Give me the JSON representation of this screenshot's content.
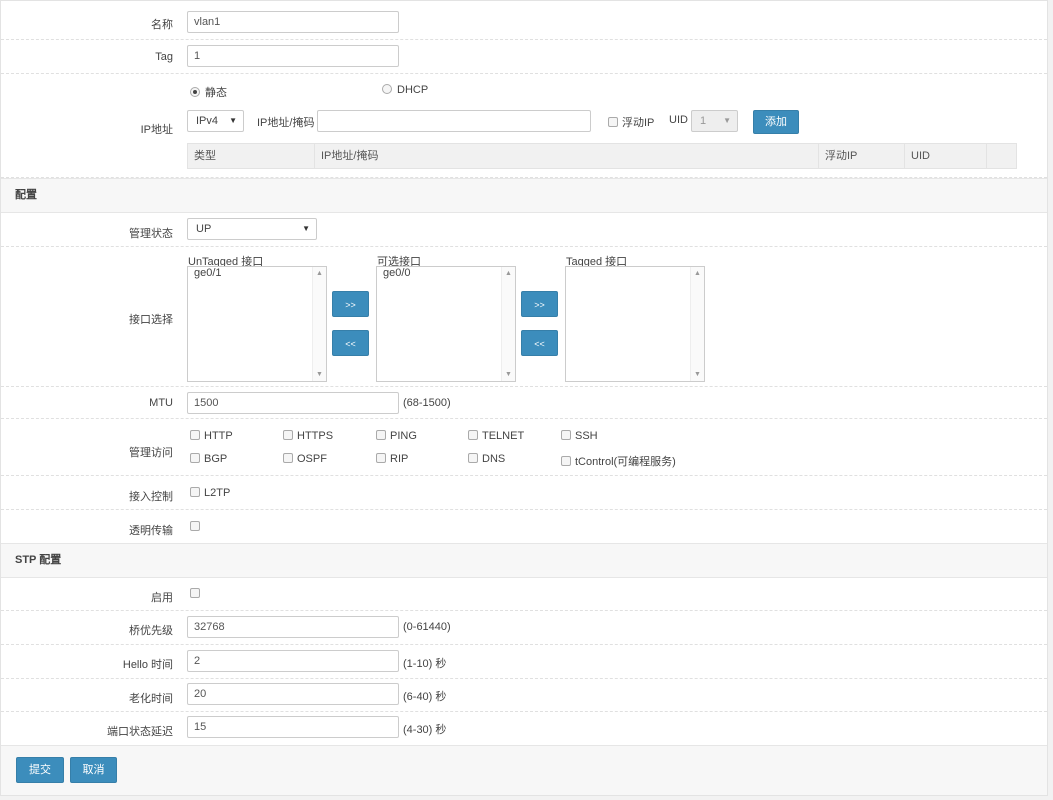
{
  "basic": {
    "name_label": "名称",
    "name_value": "vlan1",
    "tag_label": "Tag",
    "tag_value": "1",
    "ip_label": "IP地址",
    "mode_static": "静态",
    "mode_dhcp": "DHCP",
    "ip_version": "IPv4",
    "ip_mask_label": "IP地址/掩码",
    "ip_mask_value": "",
    "float_ip_label": "浮动IP",
    "uid_label": "UID",
    "uid_value": "1",
    "add_button": "添加",
    "table_headers": [
      "类型",
      "IP地址/掩码",
      "浮动IP",
      "UID",
      ""
    ]
  },
  "config": {
    "section_title": "配置",
    "admin_state_label": "管理状态",
    "admin_state_value": "UP",
    "iface_select_label": "接口选择",
    "untagged_title": "UnTagged 接口",
    "untagged_items": [
      "ge0/1"
    ],
    "available_title": "可选接口",
    "available_items": [
      "ge0/0"
    ],
    "tagged_title": "Tagged 接口",
    "tagged_items": [],
    "move_right": ">>",
    "move_left": "<<",
    "mtu_label": "MTU",
    "mtu_value": "1500",
    "mtu_hint": "(68-1500)",
    "mgmt_label": "管理访问",
    "mgmt_options": [
      "HTTP",
      "HTTPS",
      "PING",
      "TELNET",
      "SSH",
      "BGP",
      "OSPF",
      "RIP",
      "DNS",
      "tControl(可编程服务)"
    ],
    "access_label": "接入控制",
    "access_option": "L2TP",
    "transparent_label": "透明传输"
  },
  "stp": {
    "section_title": "STP 配置",
    "enable_label": "启用",
    "bridge_priority_label": "桥优先级",
    "bridge_priority_value": "32768",
    "bridge_priority_hint": "(0-61440)",
    "hello_label": "Hello 时间",
    "hello_value": "2",
    "hello_hint": "(1-10) 秒",
    "aging_label": "老化时间",
    "aging_value": "20",
    "aging_hint": "(6-40) 秒",
    "delay_label": "端口状态延迟",
    "delay_value": "15",
    "delay_hint": "(4-30) 秒"
  },
  "footer": {
    "submit": "提交",
    "cancel": "取消"
  },
  "colors": {
    "primary": "#3c8dbc",
    "section_bg": "#f7f7f7"
  }
}
